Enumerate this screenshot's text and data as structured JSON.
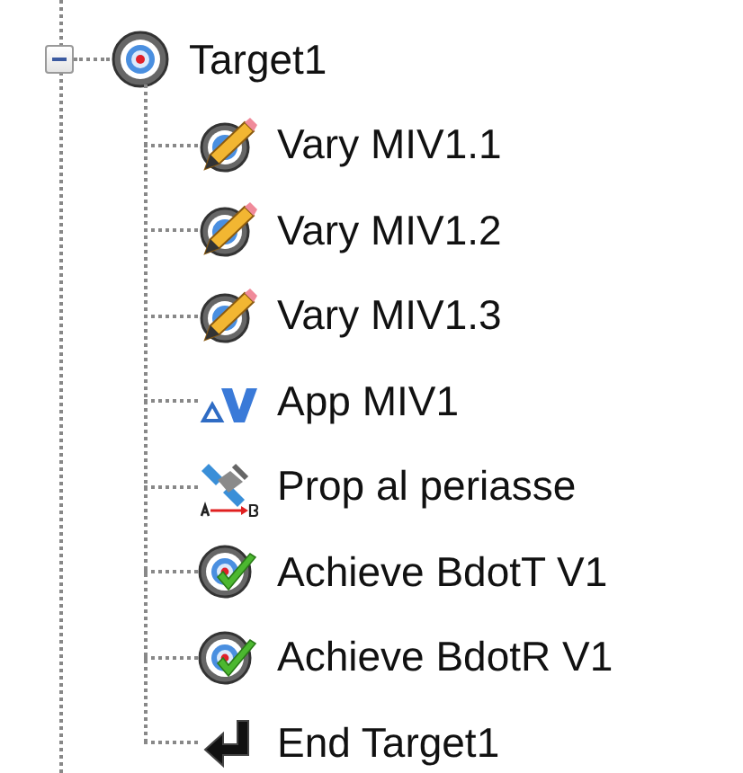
{
  "tree": {
    "label": "Target1",
    "kind": "target",
    "expanded": true,
    "children": [
      {
        "label": "Vary MIV1.1",
        "kind": "vary"
      },
      {
        "label": "Vary MIV1.2",
        "kind": "vary"
      },
      {
        "label": "Vary MIV1.3",
        "kind": "vary"
      },
      {
        "label": "App MIV1",
        "kind": "maneuver"
      },
      {
        "label": "Prop al periasse",
        "kind": "propagate"
      },
      {
        "label": "Achieve BdotT V1",
        "kind": "achieve"
      },
      {
        "label": "Achieve BdotR V1",
        "kind": "achieve"
      },
      {
        "label": "End Target1",
        "kind": "end"
      }
    ]
  }
}
